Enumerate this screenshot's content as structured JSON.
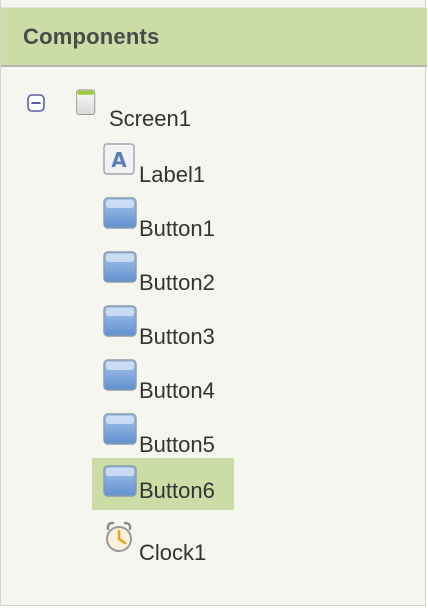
{
  "panel": {
    "title": "Components"
  },
  "tree": {
    "root": {
      "label": "Screen1",
      "icon": "screen-icon",
      "toggle_icon": "collapse-minus-icon"
    },
    "children": [
      {
        "label": "Label1",
        "icon": "label-icon",
        "selected": false
      },
      {
        "label": "Button1",
        "icon": "button-icon",
        "selected": false
      },
      {
        "label": "Button2",
        "icon": "button-icon",
        "selected": false
      },
      {
        "label": "Button3",
        "icon": "button-icon",
        "selected": false
      },
      {
        "label": "Button4",
        "icon": "button-icon",
        "selected": false
      },
      {
        "label": "Button5",
        "icon": "button-icon",
        "selected": false
      },
      {
        "label": "Button6",
        "icon": "button-icon",
        "selected": true
      },
      {
        "label": "Clock1",
        "icon": "clock-icon",
        "selected": false
      }
    ]
  },
  "colors": {
    "header_bg": "#cbdca6",
    "selected_bg": "#cbdca6",
    "panel_bg": "#f6f6f0",
    "toggle_accent": "#5b5ea6"
  }
}
